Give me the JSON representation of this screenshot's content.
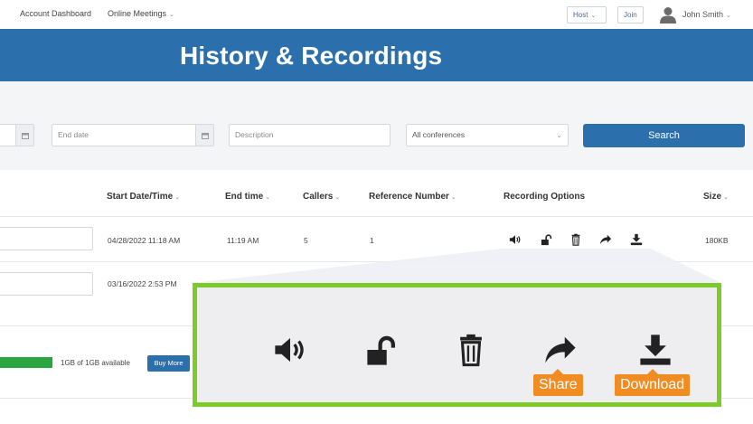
{
  "nav": {
    "account_dashboard": "Account Dashboard",
    "online_meetings": "Online Meetings",
    "host": "Host",
    "join": "Join",
    "user_name": "John Smith"
  },
  "banner": {
    "title": "History & Recordings"
  },
  "filters": {
    "end_date_placeholder": "End date",
    "description_placeholder": "Description",
    "conference_select": "All conferences",
    "search_label": "Search"
  },
  "table": {
    "headers": {
      "start": "Start Date/Time",
      "end": "End time",
      "callers": "Callers",
      "reference": "Reference Number",
      "options": "Recording Options",
      "size": "Size"
    },
    "rows": [
      {
        "start": "04/28/2022 11:18 AM",
        "end": "11:19 AM",
        "callers": "5",
        "reference": "1",
        "size": "180KB"
      },
      {
        "start": "03/16/2022 2:53 PM"
      }
    ]
  },
  "storage": {
    "used_fraction": 1.0,
    "text": "1GB of 1GB available",
    "buy_label": "Buy More",
    "bar_color": "#2aa640"
  },
  "callout": {
    "share_label": "Share",
    "download_label": "Download",
    "border_color": "#7ccb2a",
    "tag_color": "#f08c22"
  },
  "icons": [
    "volume-icon",
    "unlock-icon",
    "trash-icon",
    "share-icon",
    "download-icon",
    "calendar-icon",
    "chevron-down-icon",
    "user-avatar-icon"
  ]
}
